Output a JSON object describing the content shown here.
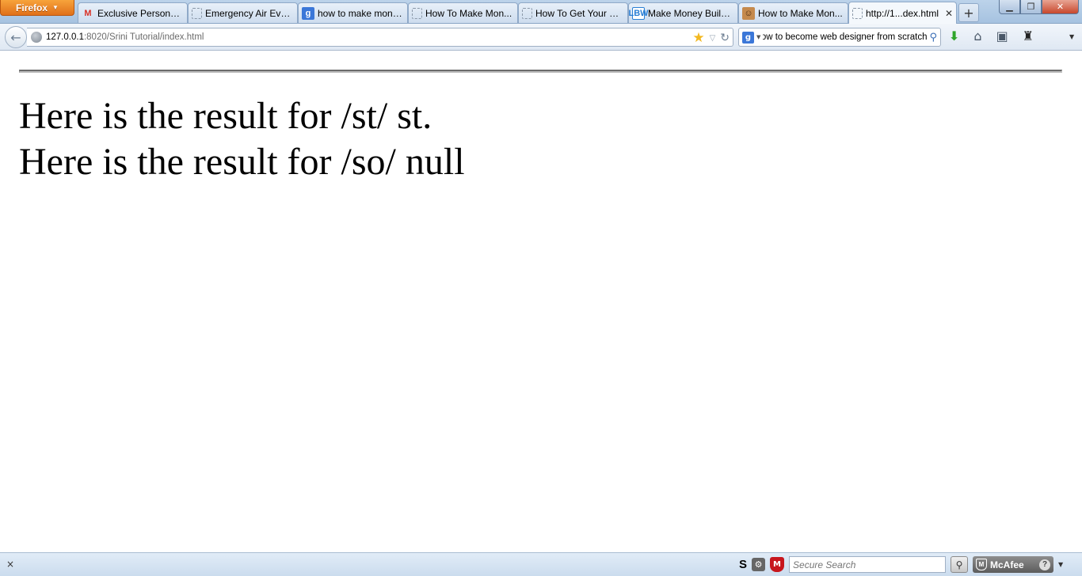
{
  "browser": {
    "app_button": "Firefox",
    "tabs": [
      {
        "label": "Exclusive Personal ...",
        "icon": "gmail-icon"
      },
      {
        "label": "Emergency Air Eva...",
        "icon": "blank-page-icon"
      },
      {
        "label": "how to make mone...",
        "icon": "google-icon"
      },
      {
        "label": "How To Make Mon...",
        "icon": "blank-page-icon"
      },
      {
        "label": "How To Get Your Fi...",
        "icon": "blank-page-icon"
      },
      {
        "label": "Make Money Buildi...",
        "icon": "lbw-icon"
      },
      {
        "label": "How to Make Mon...",
        "icon": "face-icon"
      },
      {
        "label": "http://1...dex.html",
        "icon": "blank-page-icon",
        "active": true
      }
    ],
    "new_tab": "+",
    "url_host": "127.0.0.1",
    "url_rest": ":8020/Srini Tutorial/index.html",
    "search_value": "how to become web designer from scratch",
    "search_engine_glyph": "g"
  },
  "page": {
    "line1": "Here is the result for /st/ st.",
    "line2": "Here is the result for /so/ null"
  },
  "statusbar": {
    "close_glyph": "×",
    "s_label": "S",
    "secure_search_placeholder": "Secure Search",
    "mcafee_label": "McAfee",
    "help_glyph": "?"
  },
  "colors": {
    "firefox_orange": "#e0701a",
    "chrome_blue": "#bcd3ea",
    "mcafee_red": "#c7161d"
  }
}
